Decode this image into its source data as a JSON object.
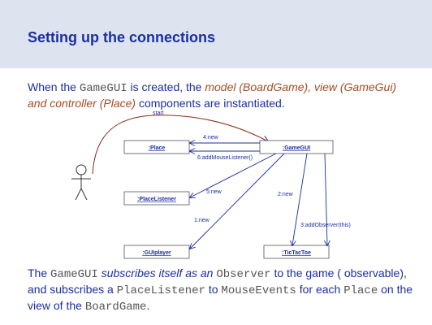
{
  "title": "Setting up the connections",
  "intro": {
    "p1": "When the ",
    "code1": "GameGUI",
    "p2": " is created, the ",
    "em1": "model (BoardGame), view (GameGui) and controller (Place)",
    "p3": " components are instantiated."
  },
  "diagram": {
    "start_label": "start",
    "objects": {
      "place": ":Place",
      "gamegui": ":GameGUI",
      "placelistener": ":PlaceListener",
      "guiplayer": ":GUIplayer",
      "tictactoe": ":TicTacToe"
    },
    "messages": {
      "m4": "4:new",
      "m6": "6:addMouseListener()",
      "m5": "5:new",
      "m2": "2:new",
      "m1": "1:new",
      "m3": "3:addObserver(this)"
    }
  },
  "outro": {
    "p1": "The ",
    "code1": "GameGUI",
    "em1": " subscribes itself as an ",
    "code2": "Observer",
    "p2": " to the game ( observable), and subscribes a ",
    "code3": "PlaceListener",
    "p3": " to ",
    "code4": "MouseEvents",
    "p4": " for each ",
    "code5": "Place",
    "p5": " on the view of the ",
    "code6": "BoardGame",
    "p6": "."
  },
  "colors": {
    "accent": "#1b2f9e",
    "emphasis": "#a64b23",
    "header_bg": "#dde4ef",
    "start_line": "#8b2a1a"
  }
}
